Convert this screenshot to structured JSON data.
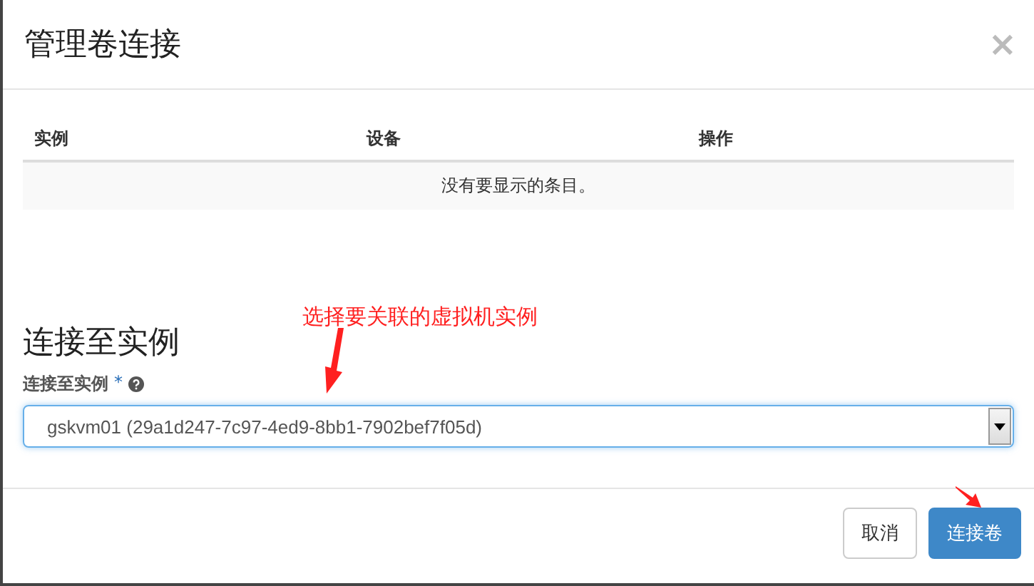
{
  "dialog": {
    "title": "管理卷连接",
    "close": "×"
  },
  "table": {
    "columns": [
      "实例",
      "设备",
      "操作"
    ],
    "empty_message": "没有要显示的条目。"
  },
  "section": {
    "title": "连接至实例",
    "field_label": "连接至实例",
    "required_mark": "*",
    "select_value": "gskvm01 (29a1d247-7c97-4ed9-8bb1-7902bef7f05d)"
  },
  "annotation": {
    "text": "选择要关联的虚拟机实例"
  },
  "buttons": [
    {
      "label": "取消",
      "kind": "default"
    },
    {
      "label": "连接卷",
      "kind": "primary"
    }
  ]
}
